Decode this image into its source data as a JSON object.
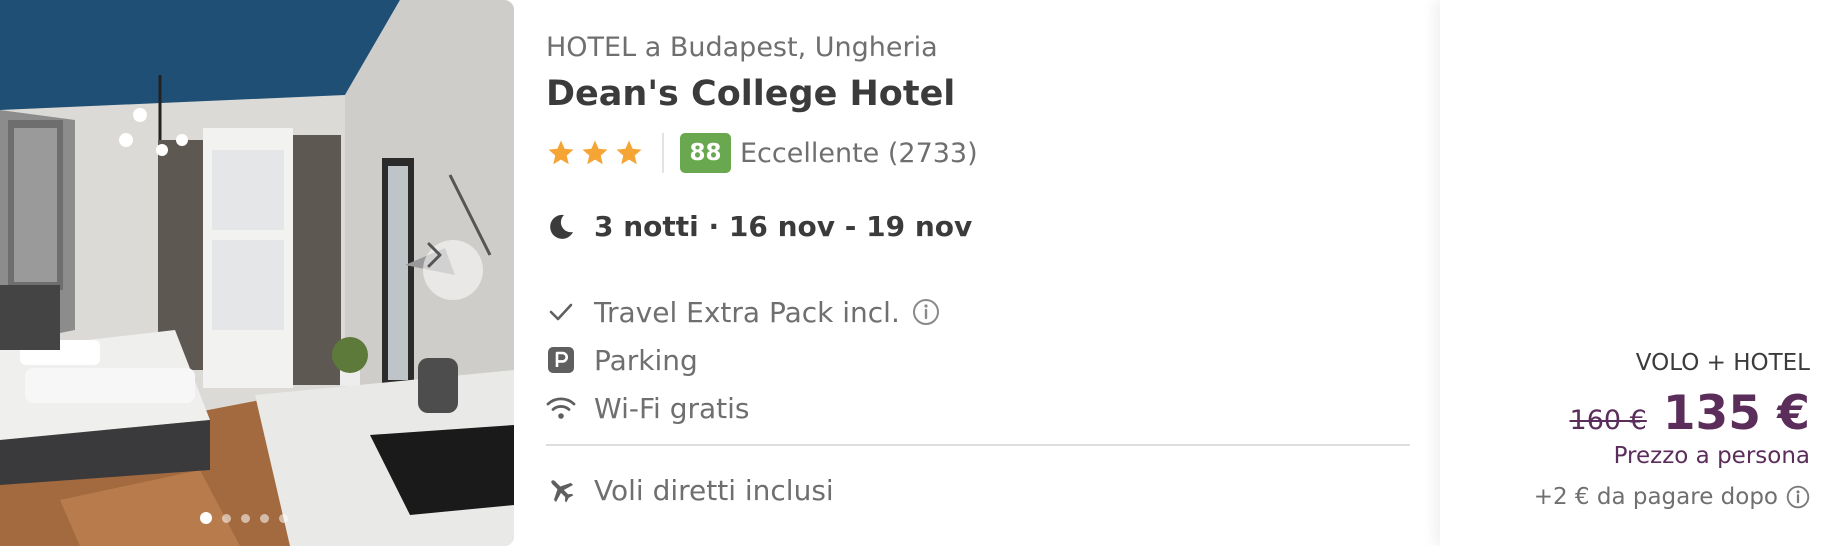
{
  "hotel": {
    "location": "HOTEL a Budapest, Ungheria",
    "name": "Dean's College Hotel",
    "stars": 3,
    "score": "88",
    "rating_text": "Eccellente (2733)",
    "dates": "3 notti · 16 nov - 19 nov"
  },
  "gallery": {
    "image_count": 5,
    "active_index": 0,
    "next_icon": "chevron-right-icon"
  },
  "features": [
    {
      "icon": "check-icon",
      "label": "Travel Extra Pack incl.",
      "has_info": true
    },
    {
      "icon": "parking-icon",
      "label": "Parking",
      "has_info": false
    },
    {
      "icon": "wifi-icon",
      "label": "Wi-Fi gratis",
      "has_info": false
    }
  ],
  "flights": {
    "icon": "airplane-icon",
    "label": "Voli diretti inclusi"
  },
  "price": {
    "package_type": "VOLO + HOTEL",
    "old_price": "160 €",
    "new_price": "135 €",
    "per_person": "Prezzo a persona",
    "extra_fee": "+2 € da pagare dopo"
  },
  "colors": {
    "score_badge": "#6aa84f",
    "price_accent": "#5b2d5a",
    "star": "#f4a535"
  }
}
